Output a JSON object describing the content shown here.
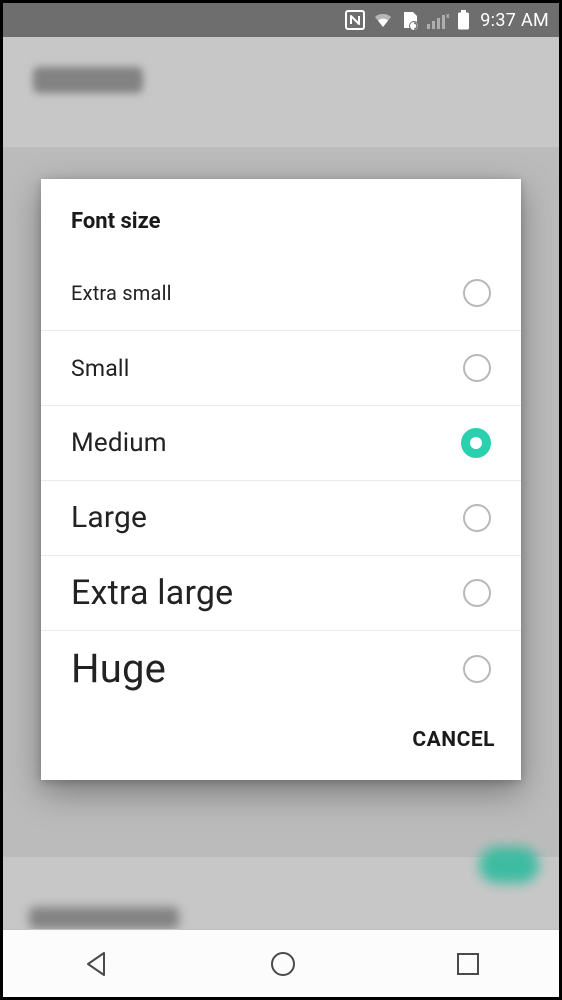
{
  "status": {
    "time": "9:37 AM"
  },
  "dialog": {
    "title": "Font size",
    "options": [
      {
        "label": "Extra small",
        "fontSize": 20,
        "selected": false
      },
      {
        "label": "Small",
        "fontSize": 23,
        "selected": false
      },
      {
        "label": "Medium",
        "fontSize": 26,
        "selected": true
      },
      {
        "label": "Large",
        "fontSize": 30,
        "selected": false
      },
      {
        "label": "Extra large",
        "fontSize": 34,
        "selected": false
      },
      {
        "label": "Huge",
        "fontSize": 40,
        "selected": false
      }
    ],
    "cancel_label": "CANCEL"
  },
  "colors": {
    "accent": "#2bd1ae"
  }
}
